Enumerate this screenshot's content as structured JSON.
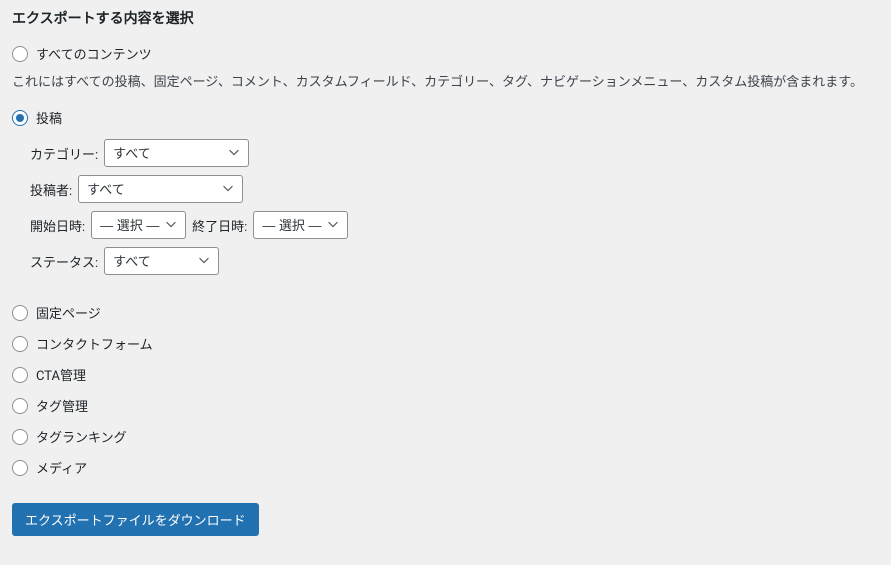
{
  "title": "エクスポートする内容を選択",
  "options": {
    "all": {
      "label": "すべてのコンテンツ",
      "description": "これにはすべての投稿、固定ページ、コメント、カスタムフィールド、カテゴリー、タグ、ナビゲーションメニュー、カスタム投稿が含まれます。"
    },
    "posts": {
      "label": "投稿"
    },
    "pages": {
      "label": "固定ページ"
    },
    "contact_form": {
      "label": "コンタクトフォーム"
    },
    "cta": {
      "label": "CTA管理"
    },
    "tag_mgmt": {
      "label": "タグ管理"
    },
    "tag_ranking": {
      "label": "タグランキング"
    },
    "media": {
      "label": "メディア"
    }
  },
  "filters": {
    "category": {
      "label": "カテゴリー:",
      "value": "すべて"
    },
    "author": {
      "label": "投稿者:",
      "value": "すべて"
    },
    "start_date": {
      "label": "開始日時:",
      "value": "— 選択 —"
    },
    "end_date": {
      "label": "終了日時:",
      "value": "— 選択 —"
    },
    "status": {
      "label": "ステータス:",
      "value": "すべて"
    }
  },
  "button": {
    "download": "エクスポートファイルをダウンロード"
  }
}
